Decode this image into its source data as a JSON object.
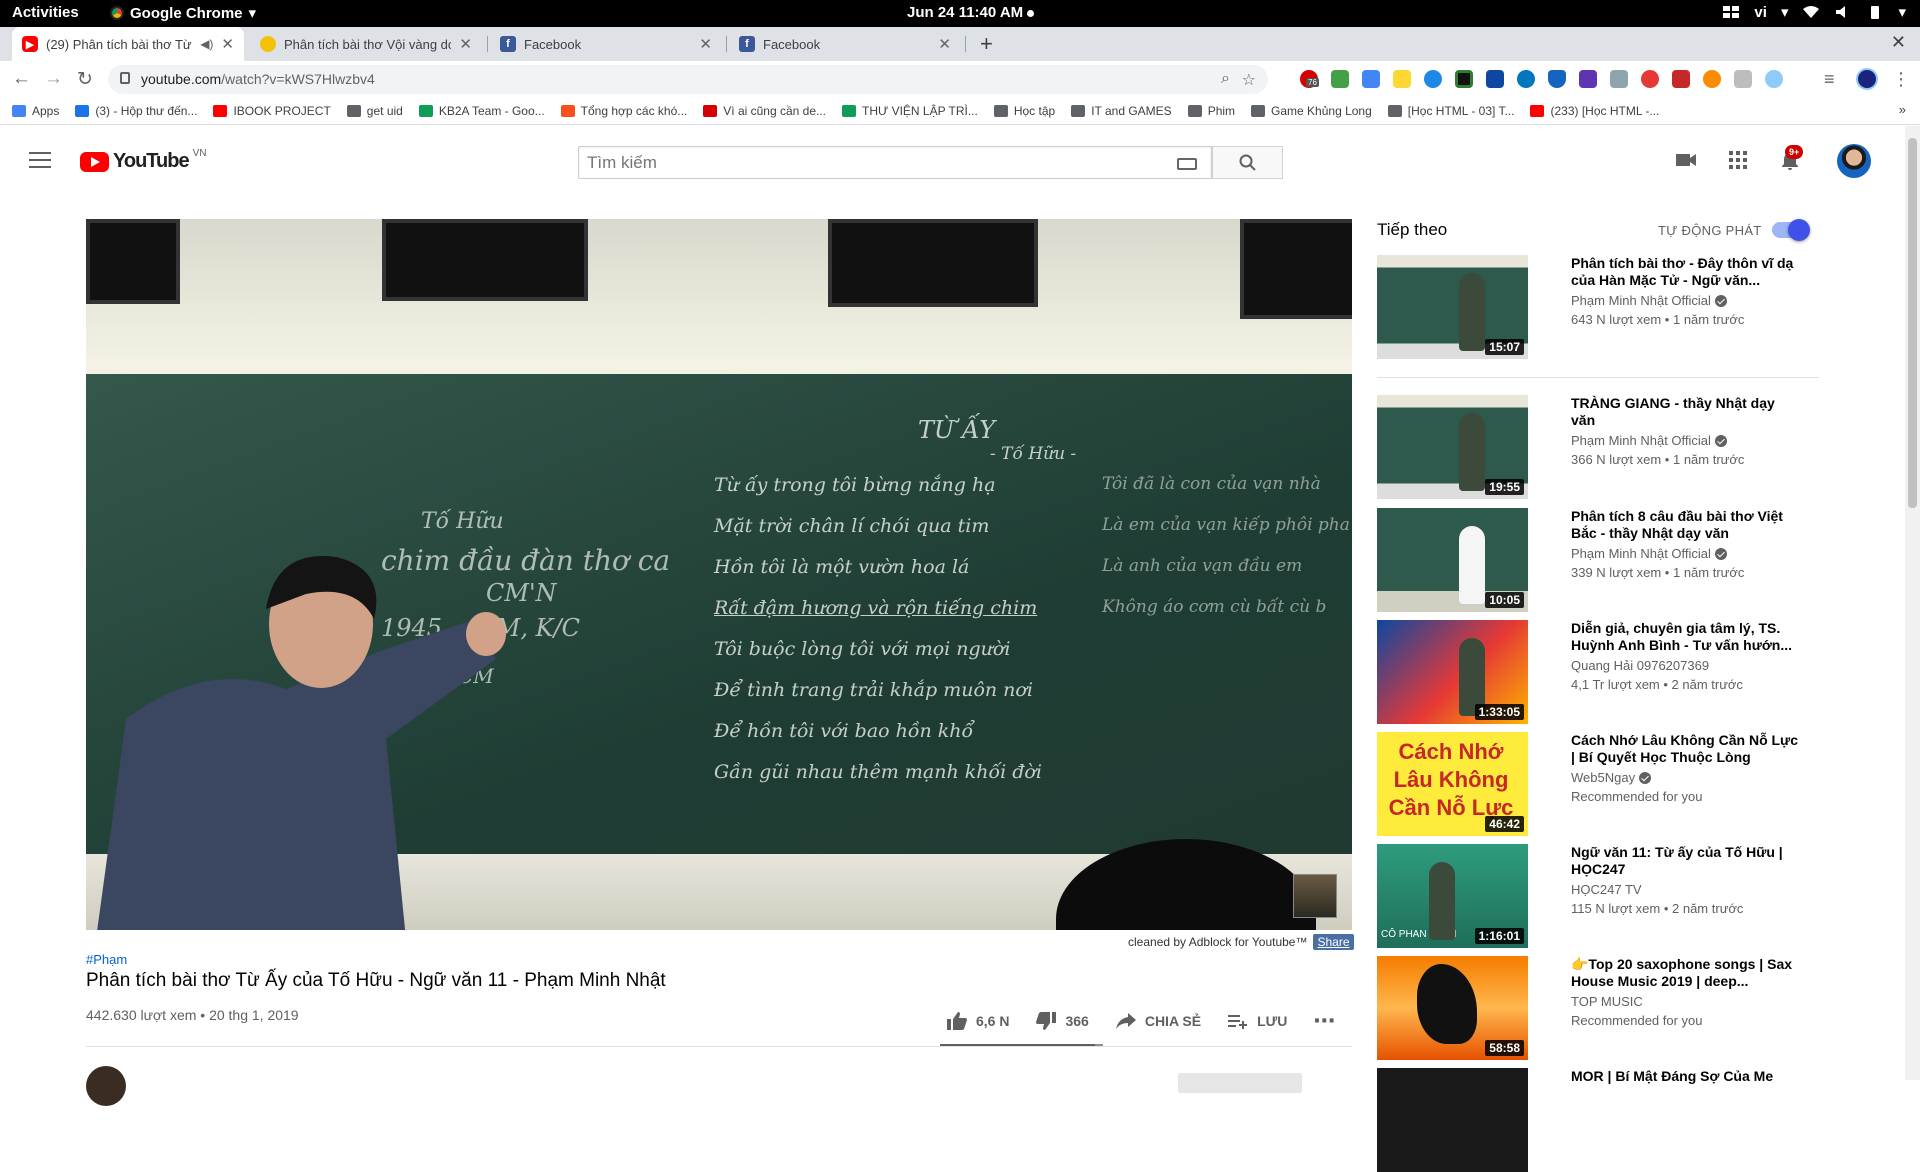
{
  "system": {
    "activities": "Activities",
    "app_name": "Google Chrome",
    "clock": "Jun 24  11:40 AM",
    "locale": "vi"
  },
  "tabs": [
    {
      "title": "(29) Phân tích bài thơ Từ Ấy",
      "favicon": "youtube-icon",
      "active": true
    },
    {
      "title": "Phân tích bài thơ Vội vàng do",
      "favicon": "bee-icon",
      "active": false
    },
    {
      "title": "Facebook",
      "favicon": "facebook-icon",
      "active": false
    },
    {
      "title": "Facebook",
      "favicon": "facebook-icon",
      "active": false
    }
  ],
  "address_bar": {
    "host": "youtube.com",
    "path": "/watch?v=kWS7Hlwzbv4",
    "ext_badge": "76"
  },
  "bookmarks": [
    {
      "label": "Apps",
      "icon": "apps-grid-icon",
      "color": "#4285f4"
    },
    {
      "label": "(3) - Hộp thư đến...",
      "icon": "mail-icon",
      "color": "#1a73e8"
    },
    {
      "label": "IBOOK PROJECT",
      "icon": "youtube-icon",
      "color": "#ff0000"
    },
    {
      "label": "get uid",
      "icon": "globe-icon",
      "color": "#5f6368"
    },
    {
      "label": "KB2A Team - Goo...",
      "icon": "drive-icon",
      "color": "#0f9d58"
    },
    {
      "label": "Tổng hợp các khó...",
      "icon": "fire-icon",
      "color": "#f4511e"
    },
    {
      "label": "Vì ai cũng cần de...",
      "icon": "heart-icon",
      "color": "#d50000"
    },
    {
      "label": "THƯ VIỆN LẬP TRÌ...",
      "icon": "plus-icon",
      "color": "#0f9d58"
    },
    {
      "label": "Học tập",
      "icon": "folder-icon",
      "color": "#5f6368"
    },
    {
      "label": "IT and GAMES",
      "icon": "folder-icon",
      "color": "#5f6368"
    },
    {
      "label": "Phim",
      "icon": "folder-icon",
      "color": "#5f6368"
    },
    {
      "label": "Game Khủng Long",
      "icon": "globe-icon",
      "color": "#5f6368"
    },
    {
      "label": "[Học HTML - 03] T...",
      "icon": "globe-icon",
      "color": "#5f6368"
    },
    {
      "label": "(233) [Học HTML -...",
      "icon": "youtube-icon",
      "color": "#ff0000"
    }
  ],
  "youtube": {
    "logo_text": "YouTube",
    "country": "VN",
    "search_placeholder": "Tìm kiếm",
    "notification_count": "9+"
  },
  "video": {
    "hashtag": "#Phạm",
    "title": "Phân tích bài thơ Từ Ấy của Tố Hữu - Ngữ văn 11 - Phạm Minh Nhật",
    "views_date": "442.630 lượt xem • 20 thg 1, 2019",
    "likes": "6,6 N",
    "dislikes": "366",
    "share": "CHIA SẺ",
    "save": "LƯU",
    "like_ratio": 0.95,
    "adblock_note": "cleaned by Adblock for Youtube™",
    "adblock_share": "Share",
    "board": {
      "title": "TỪ ẤY",
      "author": "- Tố Hữu -",
      "lines": [
        "Từ ấy trong tôi bừng nắng hạ",
        "Mặt trời chân lí chói qua tim",
        "Hồn tôi là một vườn hoa lá",
        "Rất đậm hương và rộn tiếng chim",
        "Tôi buộc lòng tôi với mọi người",
        "Để tình trang trải khắp muôn nơi",
        "Để hồn tôi với bao hồn khổ",
        "Gần gũi nhau thêm mạnh khối đời"
      ],
      "right_lines": [
        "Tôi đã là con của vạn nhà",
        "Là em của vạn kiếp phôi pha",
        "Là anh của vạn đầu em",
        "Không áo cơm cù bất cù b"
      ],
      "left_notes": [
        "Tố Hữu",
        "chim đầu đàn thơ ca",
        "CM'N",
        "1945 → CM, K/C",
        "năm 38 CM"
      ]
    }
  },
  "sidebar": {
    "up_next": "Tiếp theo",
    "autoplay": "TỰ ĐỘNG PHÁT",
    "autoplay_on": true,
    "items": [
      {
        "title": "Phân tích bài thơ - Đây thôn vĩ dạ của Hàn Mặc Tử - Ngữ văn...",
        "channel": "Phạm Minh Nhật Official",
        "verified": true,
        "meta": "643 N lượt xem • 1 năm trước",
        "duration": "15:07",
        "thumb": "classroom"
      },
      {
        "title": "TRÀNG GIANG - thầy Nhật dạy văn",
        "channel": "Phạm Minh Nhật Official",
        "verified": true,
        "meta": "366 N lượt xem • 1 năm trước",
        "duration": "19:55",
        "thumb": "classroom"
      },
      {
        "title": "Phân tích 8 câu đầu bài thơ Việt Bắc - thầy Nhật dạy văn",
        "channel": "Phạm Minh Nhật Official",
        "verified": true,
        "meta": "339 N lượt xem • 1 năm trước",
        "duration": "10:05",
        "thumb": "classroom2"
      },
      {
        "title": "Diễn giả, chuyên gia tâm lý, TS. Huỳnh Anh Bình - Tư vấn hướn...",
        "channel": "Quang Hải 0976207369",
        "verified": false,
        "meta": "4,1 Tr lượt xem • 2 năm trước",
        "duration": "1:33:05",
        "thumb": "stage"
      },
      {
        "title": "Cách Nhớ Lâu Không Cần Nỗ Lực | Bí Quyết Học Thuộc Lòng",
        "channel": "Web5Ngay",
        "verified": true,
        "meta": "Recommended for you",
        "duration": "46:42",
        "thumb": "yellow",
        "thumb_text": "Cách Nhớ Lâu Không Cần Nỗ Lực"
      },
      {
        "title": "Ngữ văn 11: Từ ấy của Tố Hữu | HỌC247",
        "channel": "HỌC247 TV",
        "verified": false,
        "meta": "115 N lượt xem • 2 năm trước",
        "duration": "1:16:01",
        "thumb": "hoc247",
        "thumb_text": "CÔ PHAN THỊ M"
      },
      {
        "title": "👉Top 20 saxophone songs | Sax House Music 2019 | deep...",
        "channel": "TOP MUSIC",
        "verified": false,
        "meta": "Recommended for you",
        "duration": "58:58",
        "thumb": "sunset"
      },
      {
        "title": "MOR | Bí Mật Đáng Sợ Của Me",
        "channel": "",
        "verified": false,
        "meta": "",
        "duration": "",
        "thumb": "dark"
      }
    ]
  }
}
